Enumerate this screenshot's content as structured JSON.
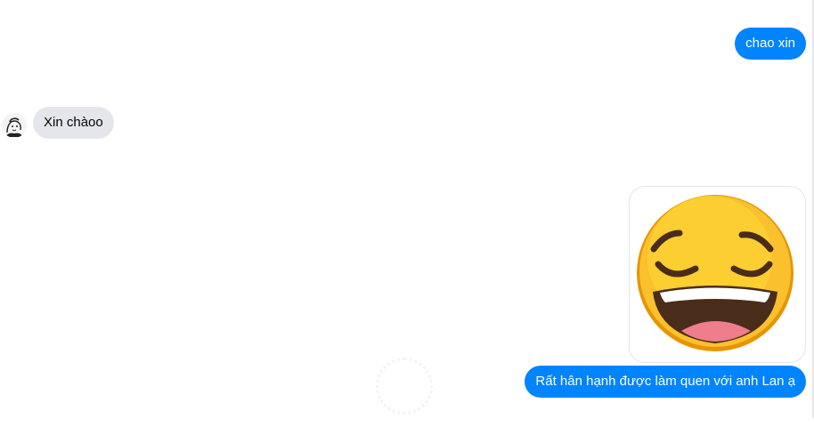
{
  "messages": [
    {
      "id": "msg-1",
      "direction": "outgoing",
      "text": "chao xin"
    },
    {
      "id": "msg-2",
      "direction": "incoming",
      "text": "Xin chàoo",
      "sender_avatar_icon": "user-avatar-sketch"
    },
    {
      "id": "msg-3",
      "direction": "outgoing",
      "type": "image",
      "icon": "relieved-laughing-face-emoji"
    },
    {
      "id": "msg-4",
      "direction": "outgoing",
      "text": "Rất hân hạnh được làm quen với anh Lan ạ"
    }
  ],
  "colors": {
    "outgoing_bubble": "#0084ff",
    "incoming_bubble": "#e4e6eb",
    "outgoing_text": "#ffffff",
    "incoming_text": "#050505",
    "emoji_face": "#fbc02d",
    "emoji_outline": "#e69500",
    "emoji_mouth": "#4a2c1a",
    "emoji_tongue": "#ef7d8c"
  },
  "indicators": {
    "loading_icon": "loading-spinner-icon"
  }
}
